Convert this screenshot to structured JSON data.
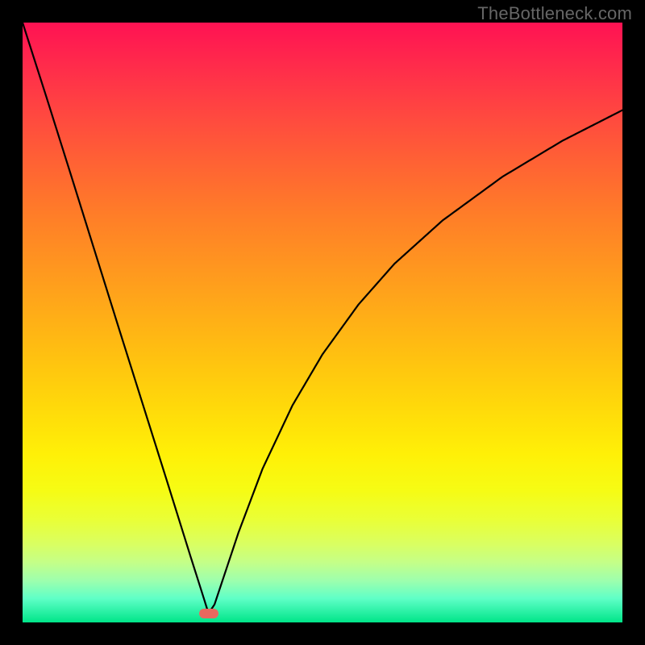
{
  "watermark_text": "TheBottleneck.com",
  "chart_data": {
    "type": "line",
    "title": "",
    "xlabel": "",
    "ylabel": "",
    "xlim": [
      0,
      100
    ],
    "ylim": [
      0,
      100
    ],
    "background_gradient": {
      "top_color": "#ff1253",
      "bottom_color": "#00e589",
      "description": "vertical gradient red→orange→yellow→green"
    },
    "series": [
      {
        "name": "bottleneck-curve",
        "description": "V-shaped curve: steep linear descent on left, minimum near x≈31, asymptotic rise on right",
        "x": [
          0,
          4,
          8,
          12,
          16,
          20,
          24,
          28,
          30,
          31,
          32,
          34,
          36,
          40,
          45,
          50,
          56,
          62,
          70,
          80,
          90,
          100
        ],
        "values": [
          100,
          87.5,
          74.8,
          62.0,
          49.2,
          36.5,
          23.8,
          11.0,
          4.7,
          1.5,
          3.0,
          9.0,
          15.0,
          25.6,
          36.2,
          44.7,
          53.0,
          59.8,
          67.0,
          74.3,
          80.3,
          85.4
        ]
      }
    ],
    "marker": {
      "description": "small rounded pink marker at curve minimum",
      "x": 31,
      "y": 1.5,
      "color": "#e8685f"
    }
  }
}
